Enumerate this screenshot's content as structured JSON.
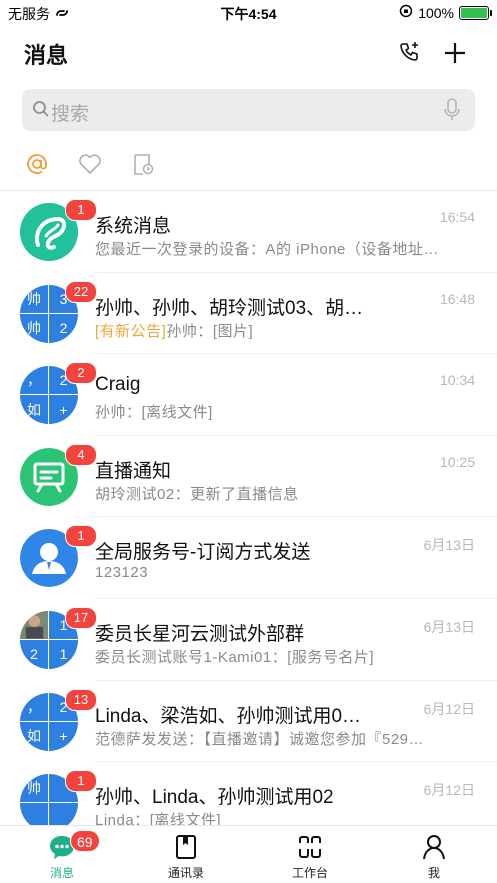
{
  "status_bar": {
    "carrier": "无服务",
    "time": "下午4:54",
    "battery": "100%",
    "battery_level": 1.0
  },
  "header": {
    "title": "消息",
    "icons": [
      "phone-contact-icon",
      "plus-icon"
    ]
  },
  "search": {
    "placeholder": "搜索"
  },
  "filters": [
    "at-mention-icon",
    "heart-icon",
    "pending-clock-icon"
  ],
  "colors": {
    "accent_orange": "#f39a3b",
    "badge_red": "#f2433c",
    "avatar_blue": "#2d7fe0",
    "teal": "#1fae8a",
    "green": "#2bc375",
    "announcement_tag": "#e9a73a"
  },
  "chats": [
    {
      "name": "系统消息",
      "time": "16:54",
      "badge": "1",
      "preview": "您最近一次登录的设备：A的 iPhone（设备地址…",
      "avatar": "teal-logo"
    },
    {
      "name": "孙帅、孙帅、胡玲测试03、胡…",
      "time": "16:48",
      "badge": "22",
      "preview_tag": "[有新公告]",
      "preview": "孙帅：[图片]",
      "avatar_quad": [
        "帅",
        "3",
        "帅",
        "2"
      ]
    },
    {
      "name": "Craig",
      "time": "10:34",
      "badge": "2",
      "preview": "孙帅：[离线文件]",
      "avatar_quad": [
        "，",
        "2",
        "如",
        "+"
      ]
    },
    {
      "name": "直播通知",
      "time": "10:25",
      "badge": "4",
      "preview": "胡玲测试02：更新了直播信息",
      "avatar": "green-live"
    },
    {
      "name": "全局服务号-订阅方式发送",
      "time": "6月13日",
      "badge": "1",
      "preview": "123123",
      "avatar": "blue-person"
    },
    {
      "name": "委员长星河云测试外部群",
      "time": "6月13日",
      "badge": "17",
      "preview": "委员长测试账号1-Kami01：[服务号名片]",
      "avatar_quad": [
        "",
        "1",
        "2",
        "1"
      ]
    },
    {
      "name": "Linda、梁浩如、孙帅测试用0…",
      "time": "6月12日",
      "badge": "13",
      "preview": "范德萨发发送：【直播邀请】诚邀您参加『529…",
      "avatar_quad": [
        "，",
        "2",
        "如",
        "+"
      ]
    },
    {
      "name": "孙帅、Linda、孙帅测试用02",
      "time": "6月12日",
      "badge": "1",
      "preview": "Linda：[离线文件]",
      "avatar_quad": [
        "帅",
        "",
        "",
        ""
      ]
    }
  ],
  "tabbar": {
    "tabs": [
      {
        "label": "消息",
        "icon": "chat-bubble-icon",
        "badge": "69"
      },
      {
        "label": "通讯录",
        "icon": "address-book-icon"
      },
      {
        "label": "工作台",
        "icon": "workbench-icon"
      },
      {
        "label": "我",
        "icon": "profile-icon"
      }
    ]
  }
}
